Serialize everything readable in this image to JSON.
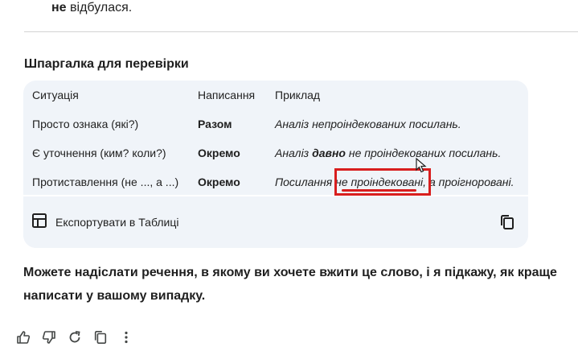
{
  "previous": {
    "bold_word": "не",
    "rest": " відбулася."
  },
  "cheatsheet": {
    "title": "Шпаргалка для перевірки",
    "headers": [
      "Ситуація",
      "Написання",
      "Приклад"
    ],
    "rows": [
      {
        "situation": "Просто ознака (які?)",
        "spelling": "Разом",
        "ex_before": "Аналіз непроіндекованих посилань.",
        "ex_bold": "",
        "ex_after": ""
      },
      {
        "situation": "Є уточнення (ким? коли?)",
        "spelling": "Окремо",
        "ex_before": "Аналіз ",
        "ex_bold": "давно",
        "ex_after": " не проіндекованих посилань."
      },
      {
        "situation": "Протиставлення (не ..., а ...)",
        "spelling": "Окремо",
        "ex_before": "Посилання не проіндековані, а проігноровані.",
        "ex_bold": "",
        "ex_after": ""
      }
    ],
    "export_label": "Експортувати в Таблиці",
    "icons": {
      "export": "table-icon",
      "copy": "copy-icon"
    }
  },
  "message": "Можете надіслати речення, в якому ви хочете вжити це слово, і я підкажу, як краще написати у вашому випадку.",
  "annotation": {
    "color": "#d81e1e"
  },
  "actions": [
    "thumbs-up-icon",
    "thumbs-down-icon",
    "regenerate-icon",
    "copy-icon",
    "more-icon"
  ]
}
